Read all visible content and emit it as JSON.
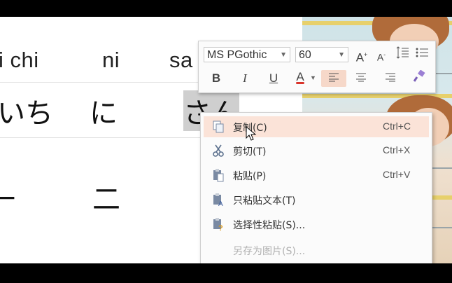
{
  "document": {
    "romaji": [
      "i chi",
      "ni",
      "sa"
    ],
    "hiragana": [
      "いち",
      "に",
      "さん"
    ],
    "kanji": [
      "一",
      "二"
    ]
  },
  "toolbar": {
    "font_name": "MS PGothic",
    "font_size": "60",
    "bold": "B",
    "italic": "I",
    "underline": "U",
    "font_color": "A",
    "grow_font": "A",
    "shrink_font": "A",
    "accent_color": "#d9342b"
  },
  "context_menu": {
    "items": [
      {
        "label": "复制(C)",
        "shortcut": "Ctrl+C",
        "icon": "copy-icon",
        "state": "hover"
      },
      {
        "label": "剪切(T)",
        "shortcut": "Ctrl+X",
        "icon": "scissors-icon",
        "state": "normal"
      },
      {
        "label": "粘贴(P)",
        "shortcut": "Ctrl+V",
        "icon": "paste-icon",
        "state": "normal"
      },
      {
        "label": "只粘贴文本(T)",
        "shortcut": "",
        "icon": "paste-text-icon",
        "state": "normal"
      },
      {
        "label": "选择性粘贴(S)...",
        "shortcut": "",
        "icon": "paste-special-icon",
        "state": "normal"
      },
      {
        "label": "另存为图片(S)...",
        "shortcut": "",
        "icon": "",
        "state": "disabled"
      }
    ],
    "hover_color": "#fbe3d8"
  }
}
